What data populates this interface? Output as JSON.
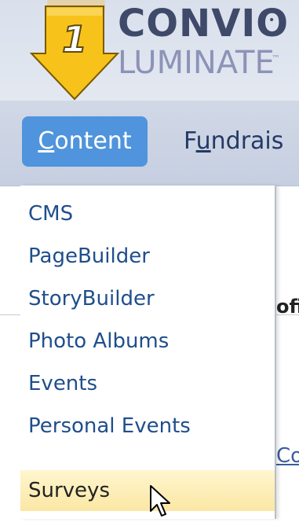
{
  "logo": {
    "word": "CONVIO",
    "reg": "•",
    "sub": "LUMINATE",
    "tm": "™"
  },
  "callout": {
    "step_number": "1",
    "arrow_color": "#f7c31b"
  },
  "nav": {
    "tabs": [
      {
        "prefix": "",
        "underlined": "C",
        "rest": "ontent",
        "active": true
      },
      {
        "prefix": "F",
        "underlined": "u",
        "rest": "ndrais",
        "active": false
      }
    ]
  },
  "background": {
    "clipped_text": "ofi",
    "clipped_link": "Cor"
  },
  "menu": {
    "items": [
      {
        "label": "CMS"
      },
      {
        "label": "PageBuilder"
      },
      {
        "label": "StoryBuilder"
      },
      {
        "label": "Photo Albums"
      },
      {
        "label": "Events"
      },
      {
        "label": "Personal Events"
      },
      {
        "label": "Surveys",
        "highlighted": true
      }
    ]
  },
  "colors": {
    "active_tab_bg": "#4f94dc",
    "menu_text": "#1f4e8c",
    "highlight_bg": "#fbe7a4"
  }
}
